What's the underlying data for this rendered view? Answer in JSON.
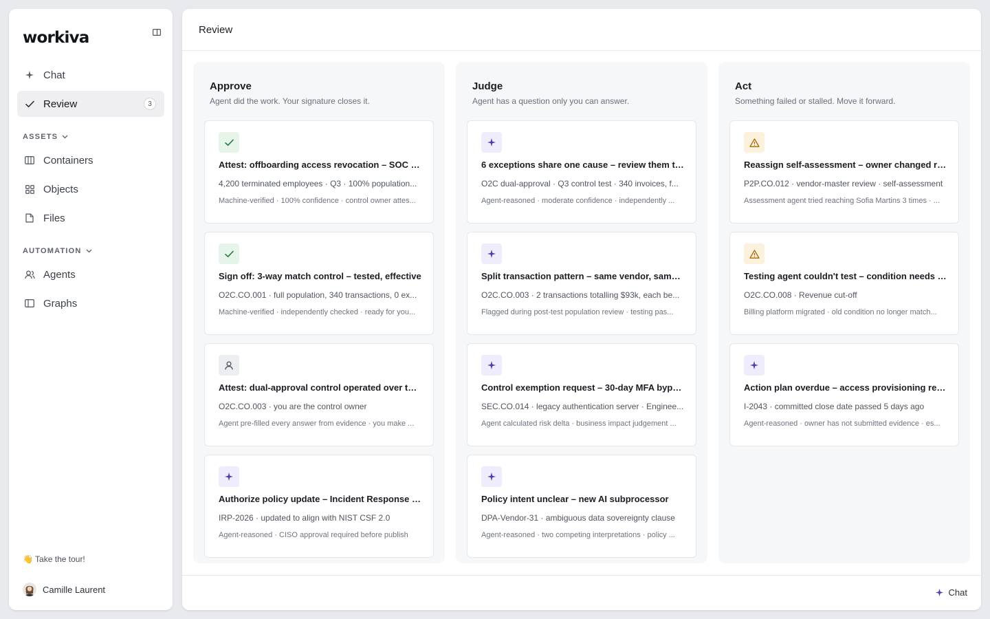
{
  "app": {
    "logo": "workiva"
  },
  "sidebar": {
    "nav": [
      {
        "label": "Chat",
        "icon": "sparkle-icon"
      },
      {
        "label": "Review",
        "icon": "check-icon",
        "count": "3",
        "active": true
      }
    ],
    "sections": [
      {
        "label": "ASSETS",
        "items": [
          {
            "label": "Containers",
            "icon": "columns-icon"
          },
          {
            "label": "Objects",
            "icon": "grid-icon"
          },
          {
            "label": "Files",
            "icon": "file-icon"
          }
        ]
      },
      {
        "label": "AUTOMATION",
        "items": [
          {
            "label": "Agents",
            "icon": "users-icon"
          },
          {
            "label": "Graphs",
            "icon": "panel-icon"
          }
        ]
      }
    ],
    "tour": "👋 Take the tour!",
    "user": {
      "name": "Camille Laurent"
    }
  },
  "main": {
    "title": "Review",
    "chat_button": "Chat",
    "columns": [
      {
        "title": "Approve",
        "subtitle": "Agent did the work. Your signature closes it.",
        "cards": [
          {
            "icon": "check-icon",
            "title": "Attest: offboarding access revocation – SOC 2 ...",
            "meta": "4,200 terminated employees · Q3 · 100% population...",
            "note": "Machine-verified · 100% confidence · control owner attes..."
          },
          {
            "icon": "check-icon",
            "title": "Sign off: 3-way match control – tested, effective",
            "meta": "O2C.CO.001 · full population, 340 transactions, 0 ex...",
            "note": "Machine-verified · independently checked · ready for you..."
          },
          {
            "icon": "person-icon",
            "title": "Attest: dual-approval control operated over the...",
            "meta": "O2C.CO.003 · you are the control owner",
            "note": "Agent pre-filled every answer from evidence · you make ..."
          },
          {
            "icon": "sparkle-icon",
            "title": "Authorize policy update – Incident Response P...",
            "meta": "IRP-2026 · updated to align with NIST CSF 2.0",
            "note": "Agent-reasoned · CISO approval required before publish"
          }
        ]
      },
      {
        "title": "Judge",
        "subtitle": "Agent has a question only you can answer.",
        "cards": [
          {
            "icon": "sparkle-icon",
            "title": "6 exceptions share one cause – review them to...",
            "meta": "O2C dual-approval · Q3 control test · 340 invoices, f...",
            "note": "Agent-reasoned · moderate confidence · independently ..."
          },
          {
            "icon": "sparkle-icon",
            "title": "Split transaction pattern – same vendor, same ...",
            "meta": "O2C.CO.003 · 2 transactions totalling $93k, each be...",
            "note": "Flagged during post-test population review · testing pas..."
          },
          {
            "icon": "sparkle-icon",
            "title": "Control exemption request – 30-day MFA bypa...",
            "meta": "SEC.CO.014 · legacy authentication server · Enginee...",
            "note": "Agent calculated risk delta · business impact judgement ..."
          },
          {
            "icon": "sparkle-icon",
            "title": "Policy intent unclear – new AI subprocessor",
            "meta": "DPA-Vendor-31 · ambiguous data sovereignty clause",
            "note": "Agent-reasoned · two competing interpretations · policy ..."
          }
        ]
      },
      {
        "title": "Act",
        "subtitle": "Something failed or stalled. Move it forward.",
        "cards": [
          {
            "icon": "warning-icon",
            "title": "Reassign self-assessment – owner changed ro...",
            "meta": "P2P.CO.012 · vendor-master review · self-assessment",
            "note": "Assessment agent tried reaching Sofia Martins 3 times · ..."
          },
          {
            "icon": "warning-icon",
            "title": "Testing agent couldn't test – condition needs c...",
            "meta": "O2C.CO.008 · Revenue cut-off",
            "note": "Billing platform migrated · old condition no longer match..."
          },
          {
            "icon": "sparkle-icon",
            "title": "Action plan overdue – access provisioning rem...",
            "meta": "I-2043 · committed close date passed 5 days ago",
            "note": "Agent-reasoned · owner has not submitted evidence · es..."
          }
        ]
      }
    ]
  }
}
